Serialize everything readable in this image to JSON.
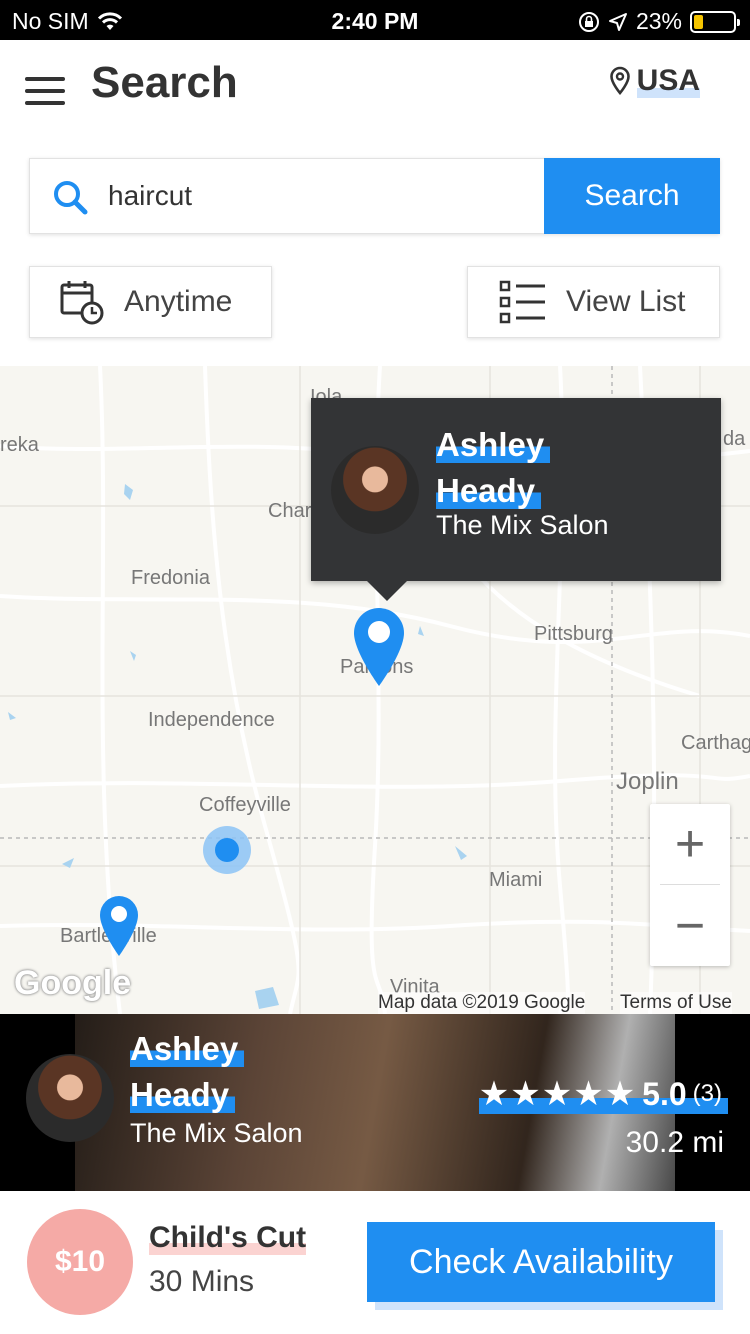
{
  "status_bar": {
    "carrier": "No SIM",
    "time": "2:40 PM",
    "battery": "23%",
    "battery_level": 0.23
  },
  "header": {
    "title": "Search",
    "region": "USA"
  },
  "search": {
    "query": "haircut",
    "button_label": "Search"
  },
  "filters": {
    "time_label": "Anytime",
    "view_label": "View List"
  },
  "map": {
    "labels": {
      "eureka": "reka",
      "iola": "Iola",
      "chanute": "Char",
      "fredonia": "Fredonia",
      "pittsburg": "Pittsburg",
      "parsons": "Parsons",
      "independence": "Independence",
      "carthage": "Carthag",
      "joplin": "Joplin",
      "coffeyville": "Coffeyville",
      "miami": "Miami",
      "bartlesville": "Bartlesville",
      "vinita": "Vinita",
      "nevada": "da"
    },
    "popup": {
      "first_name": "Ashley",
      "last_name": "Heady",
      "salon": "The Mix Salon"
    },
    "attribution": "Map data ©2019 Google",
    "terms": "Terms of Use",
    "google_logo": "Google",
    "zoom_in": "+",
    "zoom_out": "−"
  },
  "stylist_card": {
    "first_name": "Ashley",
    "last_name": "Heady",
    "salon": "The Mix Salon",
    "stars": "★★★★★",
    "rating": "5.0",
    "review_count": "(3)",
    "distance": "30.2 mi"
  },
  "service": {
    "price": "$10",
    "name": "Child's Cut",
    "duration": "30 Mins",
    "cta": "Check Availability"
  },
  "colors": {
    "accent": "#1f8ef1",
    "price_badge": "#f5aaa6",
    "popup_bg": "#333436"
  }
}
